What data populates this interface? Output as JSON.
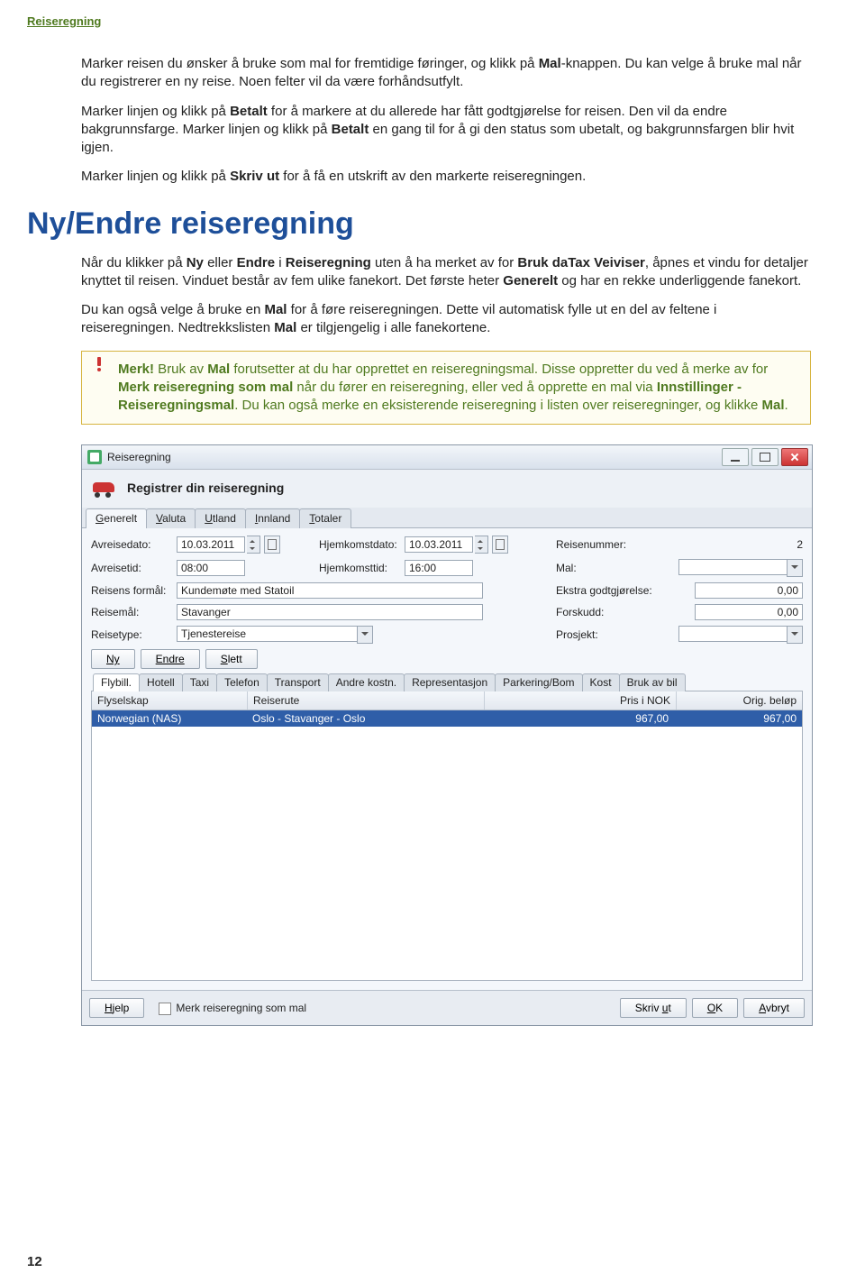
{
  "header": "Reiseregning",
  "para1_a": "Marker reisen du ønsker å bruke som mal for fremtidige føringer, og klikk på ",
  "para1_b": "Mal",
  "para1_c": "-knappen. Du kan velge å bruke mal når du registrerer en ny reise. Noen felter vil da være forhåndsutfylt.",
  "para2_a": "Marker linjen og klikk på ",
  "para2_b": "Betalt",
  "para2_c": " for å markere at du allerede har fått godtgjørelse for reisen. Den vil da endre bakgrunnsfarge. Marker linjen og klikk på ",
  "para2_d": "Betalt",
  "para2_e": " en gang til for å gi den status som ubetalt, og bakgrunnsfargen blir hvit igjen.",
  "para3_a": "Marker linjen og klikk på ",
  "para3_b": "Skriv ut",
  "para3_c": " for å få en utskrift av den markerte reiseregningen.",
  "section_heading": "Ny/Endre reiseregning",
  "para4_a": "Når du klikker på ",
  "para4_b": "Ny",
  "para4_c": " eller ",
  "para4_d": "Endre",
  "para4_e": " i ",
  "para4_f": "Reiseregning",
  "para4_g": " uten å ha merket av for ",
  "para4_h": "Bruk daTax Veiviser",
  "para4_i": ", åpnes et vindu for detaljer knyttet til reisen. Vinduet består av fem ulike fanekort. Det første heter ",
  "para4_j": "Generelt",
  "para4_k": " og har en rekke underliggende fanekort.",
  "para5_a": "Du kan også velge å bruke en ",
  "para5_b": "Mal",
  "para5_c": " for å føre reiseregningen. Dette vil automatisk fylle ut en del av feltene i reiseregningen. Nedtrekkslisten ",
  "para5_d": "Mal",
  "para5_e": " er tilgjengelig i alle fanekortene.",
  "callout_a": "Merk!",
  "callout_b": " Bruk av ",
  "callout_c": "Mal",
  "callout_d": " forutsetter at du har opprettet en reiseregningsmal. Disse oppretter du ved å merke av for ",
  "callout_e": "Merk reiseregning som mal",
  "callout_f": " når du fører en reiseregning, eller ved å opprette en mal via ",
  "callout_g": "Innstillinger - Reiseregningsmal",
  "callout_h": ". Du kan også merke en eksisterende reiseregning i listen over reiseregninger, og klikke ",
  "callout_i": "Mal",
  "callout_j": ".",
  "page_number": "12",
  "win": {
    "title": "Reiseregning",
    "header": "Registrer din reiseregning",
    "tabs": {
      "generelt": {
        "ul": "G",
        "rest": "enerelt"
      },
      "valuta": {
        "ul": "V",
        "rest": "aluta"
      },
      "utland": {
        "ul": "U",
        "rest": "tland"
      },
      "innland": {
        "ul": "I",
        "rest": "nnland"
      },
      "totaler": {
        "ul": "T",
        "rest": "otaler"
      }
    },
    "labels": {
      "avreisedato": "Avreisedato:",
      "avreisetid": "Avreisetid:",
      "formaal": "Reisens formål:",
      "reisemaal": "Reisemål:",
      "reisetype": "Reisetype:",
      "hjemkomstdato": "Hjemkomstdato:",
      "hjemkomsttid": "Hjemkomsttid:",
      "reisenummer": "Reisenummer:",
      "mal": "Mal:",
      "ekstra": "Ekstra godtgjørelse:",
      "forskudd": "Forskudd:",
      "prosjekt": "Prosjekt:"
    },
    "fields": {
      "avreisedato": "10.03.2011",
      "avreisetid": "08:00",
      "hjemkomstdato": "10.03.2011",
      "hjemkomsttid": "16:00",
      "formaal": "Kundemøte med Statoil",
      "reisemaal": "Stavanger",
      "reisetype": "Tjenestereise",
      "reisenummer": "2",
      "mal": "",
      "ekstra": "0,00",
      "forskudd": "0,00",
      "prosjekt": ""
    },
    "btnrow": {
      "ny": "Ny",
      "endre": "Endre",
      "slett": {
        "ul": "S",
        "rest": "lett"
      }
    },
    "subtabs": {
      "flybill": {
        "ul": "F",
        "rest": "lybill."
      },
      "hotell": {
        "ul": "H",
        "rest": "otell"
      },
      "taxi": {
        "text": "Ta",
        "ul": "x",
        "rest": "i"
      },
      "telefon": {
        "text": "Te",
        "ul": "l",
        "rest": "efon"
      },
      "transport": "Transport",
      "andre": {
        "ul": "A",
        "rest": "ndre kostn."
      },
      "rep": "Representasjon",
      "parkering": {
        "ul": "P",
        "rest": "arkering/Bom"
      },
      "kost": {
        "ul": "K",
        "rest": "ost"
      },
      "bruk": {
        "ul": "B",
        "rest": "ruk av bil"
      }
    },
    "table": {
      "headers": {
        "c1": "Flyselskap",
        "c2": "Reiserute",
        "c3": "Pris i NOK",
        "c4": "Orig. beløp"
      },
      "row": {
        "c1": "Norwegian (NAS)",
        "c2": "Oslo - Stavanger - Oslo",
        "c3": "967,00",
        "c4": "967,00"
      }
    },
    "footer": {
      "hjelp": {
        "ul": "H",
        "rest": "jelp"
      },
      "chk_label": "Merk reiseregning som mal",
      "skrivut": {
        "text": "Skriv ",
        "ul": "u",
        "rest": "t"
      },
      "ok": {
        "ul": "O",
        "rest": "K"
      },
      "avbryt": {
        "ul": "A",
        "rest": "vbryt"
      }
    }
  }
}
